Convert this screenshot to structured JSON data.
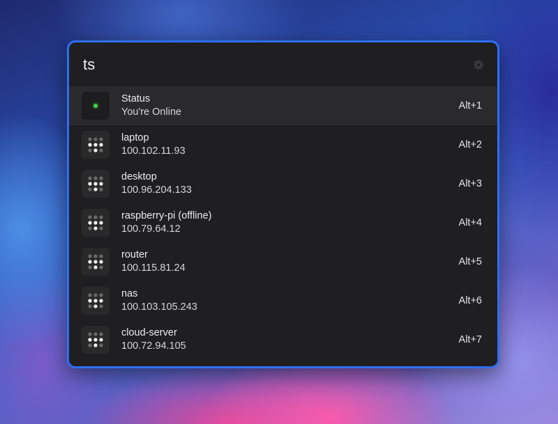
{
  "search": {
    "query": "ts"
  },
  "settings": {
    "icon": "gear-icon"
  },
  "results": [
    {
      "name": "status",
      "title": "Status",
      "subtitle": "You're Online",
      "shortcut": "Alt+1",
      "icon": "status-dot-icon",
      "selected": true
    },
    {
      "name": "laptop",
      "title": "laptop",
      "subtitle": "100.102.11.93",
      "shortcut": "Alt+2",
      "icon": "device-grid-icon"
    },
    {
      "name": "desktop",
      "title": "desktop",
      "subtitle": "100.96.204.133",
      "shortcut": "Alt+3",
      "icon": "device-grid-icon"
    },
    {
      "name": "raspberry-pi",
      "title": "raspberry-pi (offline)",
      "subtitle": "100.79.64.12",
      "shortcut": "Alt+4",
      "icon": "device-grid-icon"
    },
    {
      "name": "router",
      "title": "router",
      "subtitle": "100.115.81.24",
      "shortcut": "Alt+5",
      "icon": "device-grid-icon"
    },
    {
      "name": "nas",
      "title": "nas",
      "subtitle": "100.103.105.243",
      "shortcut": "Alt+6",
      "icon": "device-grid-icon"
    },
    {
      "name": "cloud-server",
      "title": "cloud-server",
      "subtitle": "100.72.94.105",
      "shortcut": "Alt+7",
      "icon": "device-grid-icon"
    }
  ],
  "colors": {
    "accent_border": "#2f6ef1",
    "online_green": "#47d14a",
    "panel_bg": "#1f1f21",
    "selected_bg": "#2a2a2c"
  }
}
